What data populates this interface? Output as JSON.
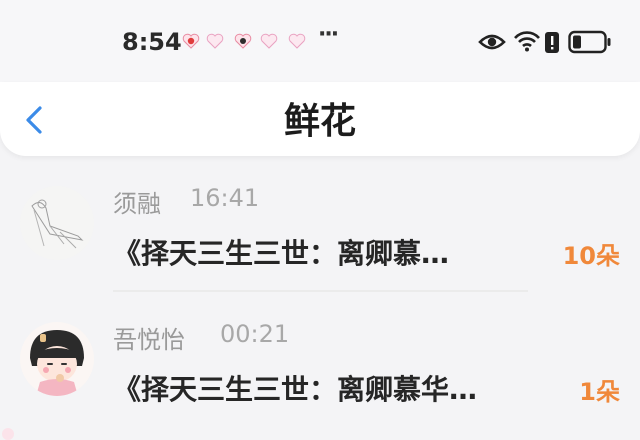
{
  "status_bar": {
    "time": "8:54",
    "more": "···",
    "icons": [
      "notification-icons",
      "eye-icon",
      "wifi-icon",
      "battery-saver-icon",
      "battery-icon"
    ]
  },
  "header": {
    "title": "鲜花",
    "back_icon": "chevron-left-icon"
  },
  "colors": {
    "accent_blue": "#3b8be8",
    "count_orange": "#f0883a",
    "name_gray": "#9a9a9a"
  },
  "items": [
    {
      "name": "须融",
      "time": "16:41",
      "message": "《择天三生三世：离卿慕…",
      "count": "10朵"
    },
    {
      "name": "吾悦怡",
      "time": "00:21",
      "message": "《择天三生三世：离卿慕华…",
      "count": "1朵"
    }
  ]
}
